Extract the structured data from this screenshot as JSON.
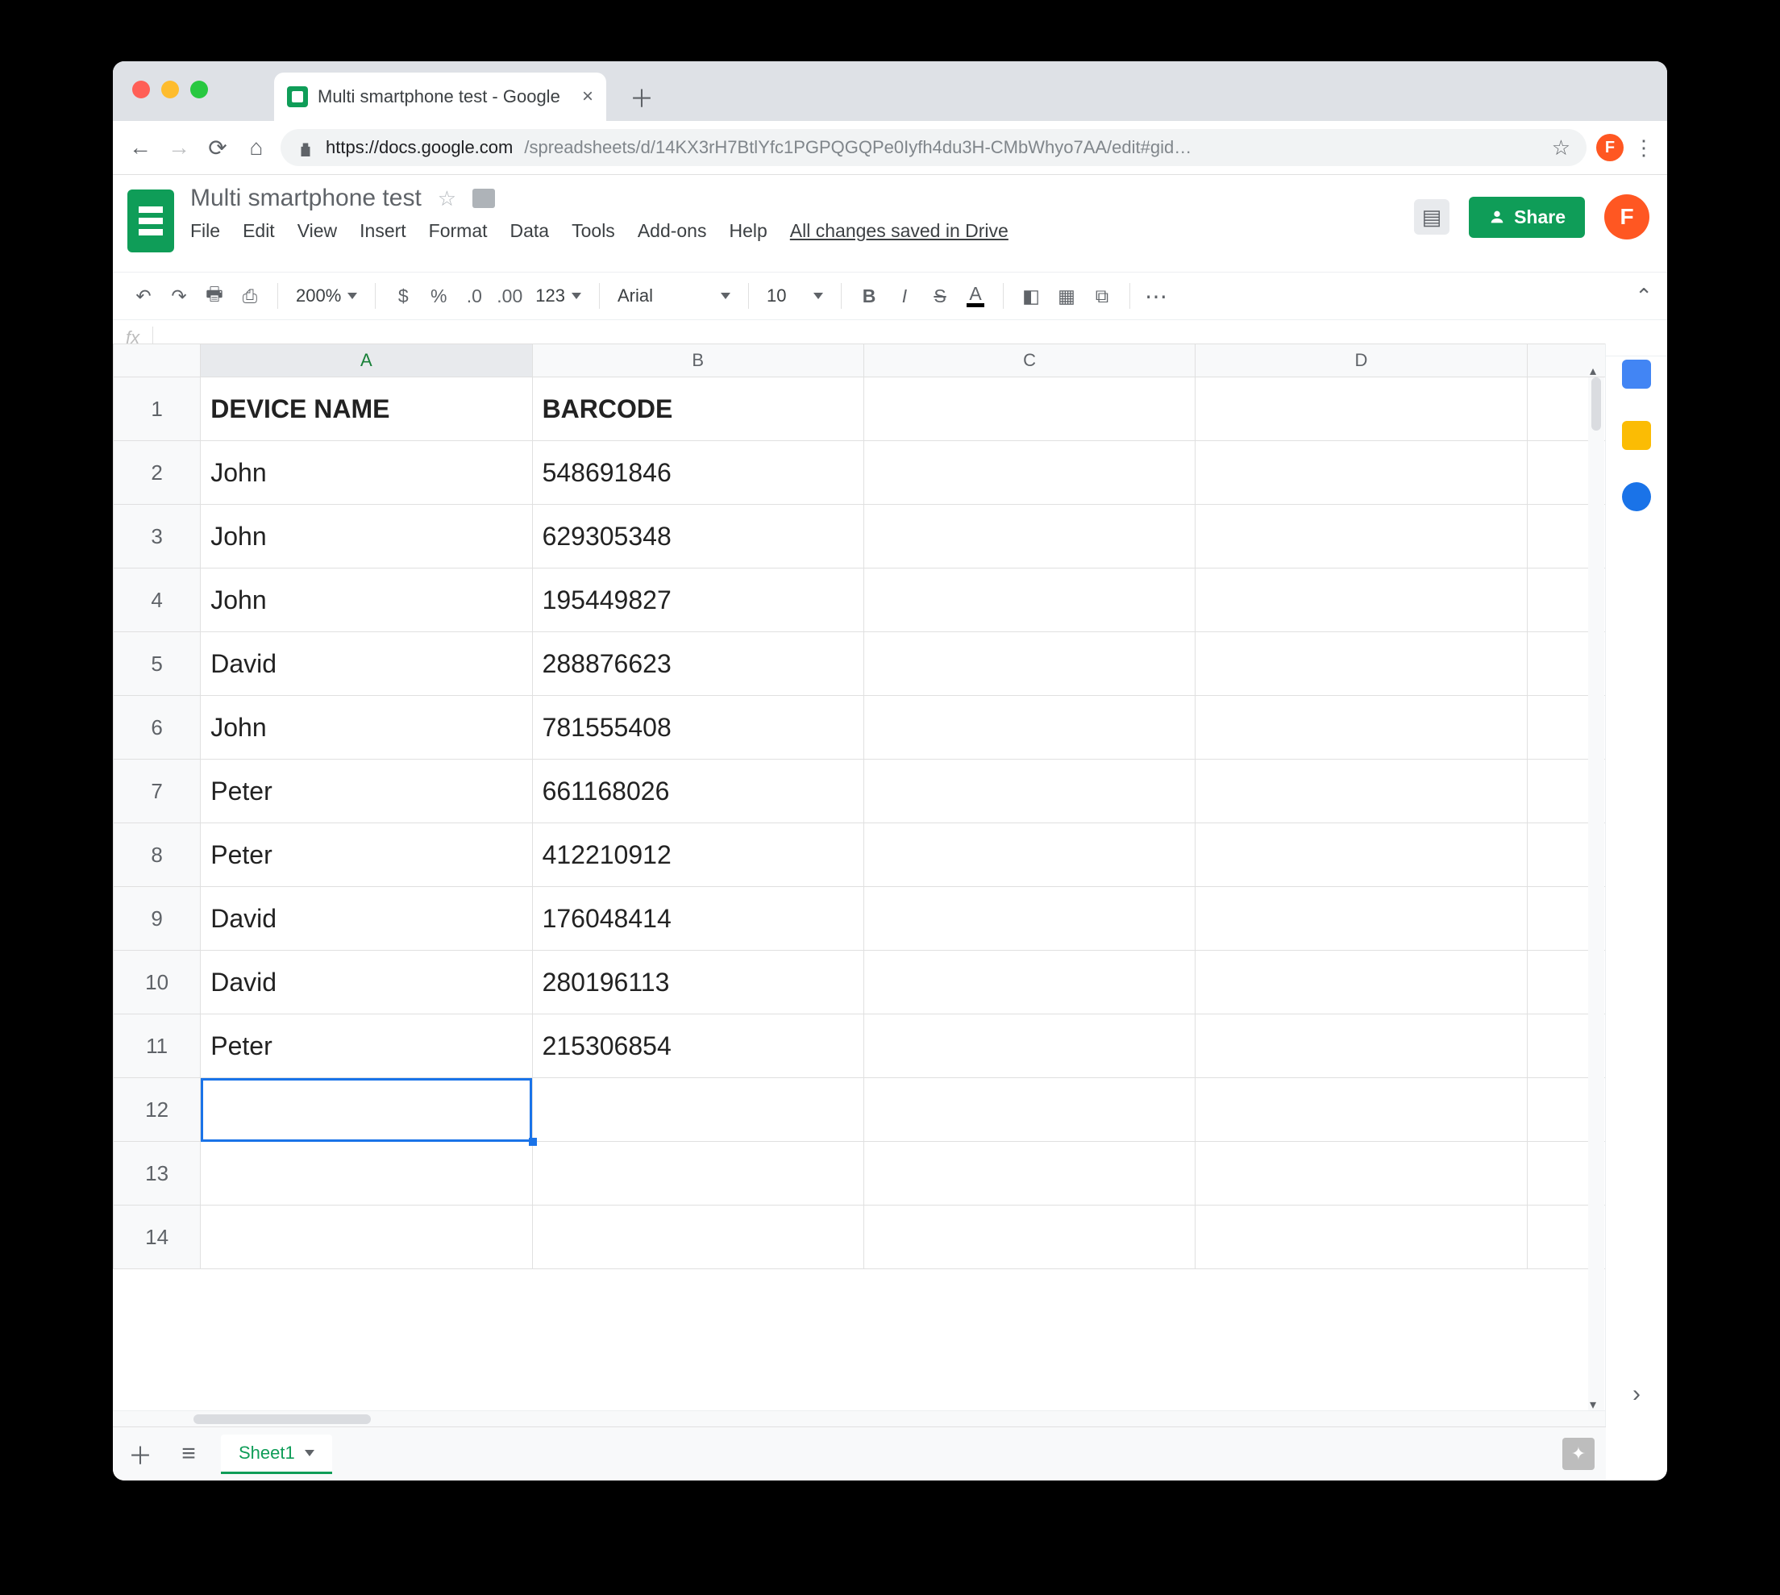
{
  "browser": {
    "tab_title": "Multi smartphone test - Google",
    "url_host": "https://docs.google.com",
    "url_path": "/spreadsheets/d/14KX3rH7BtlYfc1PGPQGQPe0Iyfh4du3H-CMbWhyo7AA/edit#gid…",
    "avatar_letter": "F"
  },
  "sheets": {
    "doc_title": "Multi smartphone test",
    "menus": [
      "File",
      "Edit",
      "View",
      "Insert",
      "Format",
      "Data",
      "Tools",
      "Add-ons",
      "Help"
    ],
    "save_status": "All changes saved in Drive",
    "share_label": "Share",
    "avatar_letter": "F"
  },
  "toolbar": {
    "zoom": "200%",
    "font": "Arial",
    "font_size": "10"
  },
  "formula_bar": {
    "fx_label": "fx"
  },
  "grid": {
    "columns": [
      "A",
      "B",
      "C",
      "D"
    ],
    "selected_column_index": 0,
    "selected_cell": "A12",
    "rows": [
      {
        "n": "1",
        "A": "DEVICE NAME",
        "B": "BARCODE",
        "bold": true
      },
      {
        "n": "2",
        "A": "John",
        "B": "548691846"
      },
      {
        "n": "3",
        "A": "John",
        "B": "629305348"
      },
      {
        "n": "4",
        "A": "John",
        "B": "195449827"
      },
      {
        "n": "5",
        "A": "David",
        "B": "288876623"
      },
      {
        "n": "6",
        "A": "John",
        "B": "781555408"
      },
      {
        "n": "7",
        "A": "Peter",
        "B": "661168026"
      },
      {
        "n": "8",
        "A": "Peter",
        "B": "412210912"
      },
      {
        "n": "9",
        "A": "David",
        "B": "176048414"
      },
      {
        "n": "10",
        "A": "David",
        "B": "280196113"
      },
      {
        "n": "11",
        "A": "Peter",
        "B": "215306854"
      },
      {
        "n": "12",
        "A": "",
        "B": ""
      },
      {
        "n": "13",
        "A": "",
        "B": ""
      },
      {
        "n": "14",
        "A": "",
        "B": ""
      }
    ]
  },
  "footer": {
    "sheet_name": "Sheet1"
  }
}
